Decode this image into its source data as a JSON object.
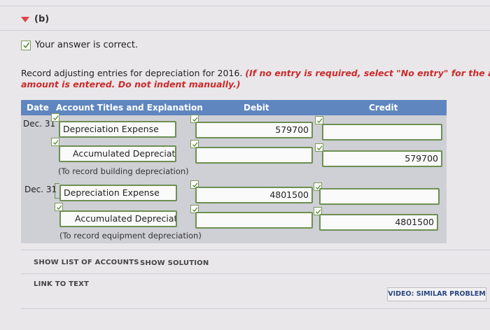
{
  "section": {
    "label": "(b)"
  },
  "status": {
    "text": "Your answer is correct."
  },
  "instructions": {
    "main": "Record adjusting entries for depreciation for 2016. ",
    "emphasis_line1": "(If no entry is required, select \"No entry\" for the a",
    "emphasis_line2": "amount is entered. Do not indent manually.)"
  },
  "table": {
    "headers": {
      "date": "Date",
      "account": "Account Titles and Explanation",
      "debit": "Debit",
      "credit": "Credit"
    }
  },
  "entries": [
    {
      "date": "Dec. 31",
      "debit_account": "Depreciation Expense",
      "debit_amount": "579700",
      "credit_account": "Accumulated Depreciati",
      "credit_amount": "579700",
      "explanation": "(To record building depreciation)"
    },
    {
      "date": "Dec. 31",
      "debit_account": "Depreciation Expense",
      "debit_amount": "4801500",
      "credit_account": "Accumulated Depreciati",
      "credit_amount": "4801500",
      "explanation": "(To record equipment depreciation)"
    }
  ],
  "buttons": {
    "show_accounts": "SHOW LIST OF ACCOUNTS",
    "show_solution": "SHOW SOLUTION",
    "link_to_text": "LINK TO TEXT",
    "video": "VIDEO: SIMILAR PROBLEM"
  },
  "colors": {
    "header_bg": "#5f86bf",
    "field_border": "#6c8f52",
    "emphasis_red": "#cc2b2b"
  }
}
